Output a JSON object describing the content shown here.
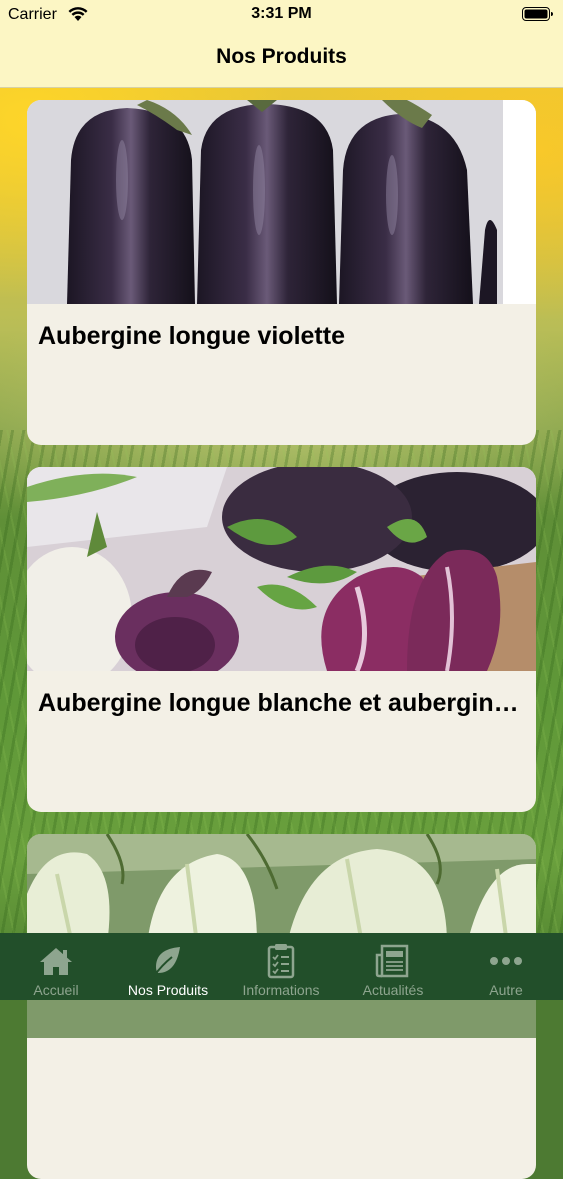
{
  "status_bar": {
    "carrier": "Carrier",
    "time": "3:31 PM"
  },
  "nav": {
    "title": "Nos Produits"
  },
  "products": [
    {
      "title": "Aubergine longue violette",
      "image": "eggplant-purple-photo"
    },
    {
      "title": "Aubergine longue blanche et aubergine ronde violette et blanche",
      "image": "eggplant-mixed-photo"
    },
    {
      "title": "",
      "image": "fennel-photo"
    }
  ],
  "tab_bar": {
    "tabs": [
      {
        "label": "Accueil",
        "icon": "home-icon"
      },
      {
        "label": "Nos Produits",
        "icon": "leaf-icon",
        "active": true
      },
      {
        "label": "Informations",
        "icon": "clipboard-icon"
      },
      {
        "label": "Actualités",
        "icon": "newspaper-icon"
      },
      {
        "label": "Autre",
        "icon": "more-icon"
      }
    ]
  },
  "colors": {
    "bar_background": "#fcf6c4",
    "tab_bar_background": "#224f2a",
    "tab_inactive": "#8ea58f",
    "tab_active": "#ffffff",
    "card_background": "#f3f0e6"
  }
}
